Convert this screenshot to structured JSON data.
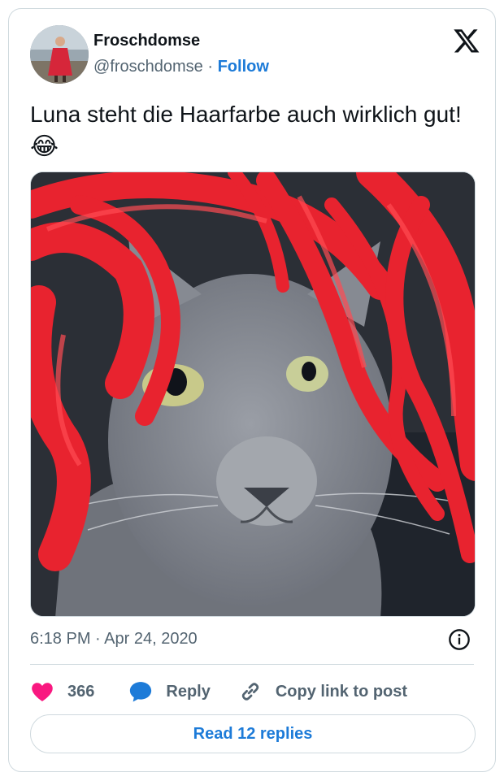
{
  "author": {
    "display_name": "Froschdomse",
    "handle": "@froschdomse",
    "separator": "·",
    "follow_label": "Follow"
  },
  "tweet": {
    "text": "Luna steht die Haarfarbe auch wirklich gut!",
    "emoji": "😂",
    "timestamp": "6:18 PM · Apr 24, 2020"
  },
  "actions": {
    "like_count": "366",
    "reply_label": "Reply",
    "copy_link_label": "Copy link to post"
  },
  "footer": {
    "read_replies_label": "Read 12 replies"
  },
  "icons": {
    "logo": "x-logo-icon",
    "info": "info-icon",
    "like": "heart-icon",
    "reply": "speech-bubble-icon",
    "copy": "link-icon"
  },
  "colors": {
    "accent": "#1d7bd8",
    "like": "#f91880",
    "text": "#0f1419",
    "muted": "#536471",
    "border": "#cfd9de"
  }
}
